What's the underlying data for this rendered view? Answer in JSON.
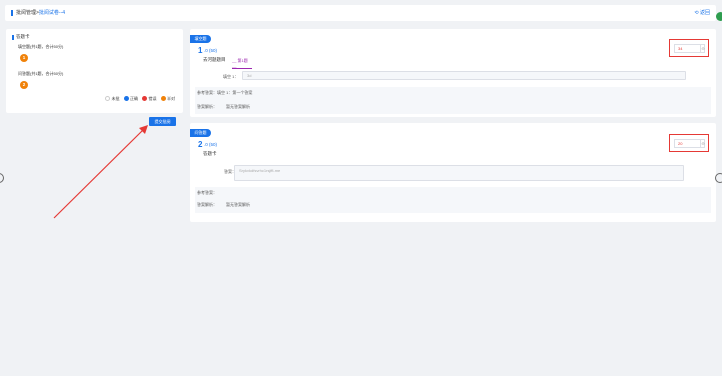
{
  "header": {
    "breadcrumb_root": "批阅管理>",
    "breadcrumb_current": "批阅试卷--4",
    "back_label": "返回"
  },
  "answer_card": {
    "title": "答题卡",
    "sections": [
      {
        "label": "填空题(共1题，合计50分)",
        "numbers": [
          "1"
        ]
      },
      {
        "label": "问答题(共1题，合计50分)",
        "numbers": [
          "2"
        ]
      }
    ],
    "legend": [
      {
        "label": "未批",
        "color": "#ffffff"
      },
      {
        "label": "正确",
        "color": "#1a73e8"
      },
      {
        "label": "错误",
        "color": "#e53935"
      },
      {
        "label": "半对",
        "color": "#f0820a"
      }
    ],
    "submit_label": "提交批阅"
  },
  "questions": [
    {
      "type_tag": "填空题",
      "number": "1",
      "points": ".0 (50)",
      "stem": "去河题题目",
      "blank": "__ 第1题 __",
      "answer_label": "填空 1：",
      "answer_value": "3d",
      "reference_answer_label": "参考答案：",
      "reference_answer": "填空 1：第一个答案",
      "analysis_label": "答案解析：",
      "analysis": "暂无答案解析",
      "score_value": "34"
    },
    {
      "type_tag": "问答题",
      "number": "2",
      "points": ".0 (50)",
      "stem": "答题卡",
      "answer_label": "答案：",
      "answer_value": "Srykvkdfsvrhc1rsjffi-me",
      "reference_answer_label": "参考答案：",
      "reference_answer": "",
      "analysis_label": "答案解析：",
      "analysis": "暂无答案解析",
      "score_value": "20"
    }
  ]
}
